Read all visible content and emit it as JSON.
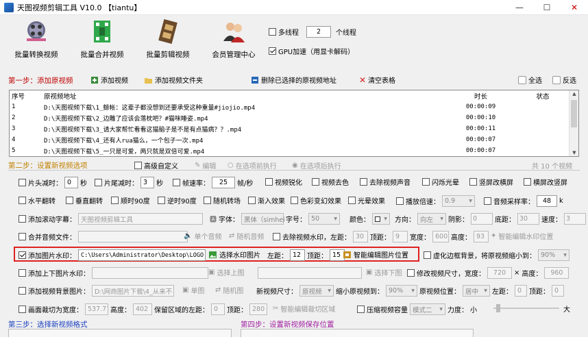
{
  "window": {
    "title": "天图视频剪辑工具 V10.0  【tiantu】",
    "minimize": "—",
    "maximize": "☐",
    "close": "✕"
  },
  "toolbar": {
    "batch_convert": "批量转换视频",
    "batch_merge": "批量合并视频",
    "batch_edit": "批量剪辑视频",
    "member_center": "会员管理中心",
    "multithread_label": "多线程",
    "thread_count": "2",
    "thread_unit": "个线程",
    "gpu_label": "GPU加速（用显卡解码）"
  },
  "step1": {
    "title": "第一步：添加原视频",
    "add_video": "添加视频",
    "add_folder": "添加视频文件夹",
    "delete_selected": "删除已选择的原视频地址",
    "clear_table": "清空表格",
    "select_all": "全选",
    "invert": "反选"
  },
  "table": {
    "headers": [
      "序号",
      "原视频地址",
      "时长",
      "状态"
    ],
    "rows": [
      {
        "n": "1",
        "path": "D:\\天图视频下载\\1_鲸帐：这辈子都没想到还要承受这种重量#jiojio.mp4",
        "dur": "00:00:09"
      },
      {
        "n": "2",
        "path": "D:\\天图视频下载\\2_边雕了应该会落枕吧？#猫咪睡姿.mp4",
        "dur": "00:00:10"
      },
      {
        "n": "3",
        "path": "D:\\天图视频下载\\3_请大家帮忙看看这猫脑子是不是有点猫病？？.mp4",
        "dur": "00:00:11"
      },
      {
        "n": "4",
        "path": "D:\\天图视频下载\\4_还有人rua猫么，一个包子一次.mp4",
        "dur": "00:00:07"
      },
      {
        "n": "5",
        "path": "D:\\天图视频下载\\5_一只是可爱，两只就是双倍可爱.mp4",
        "dur": "00:00:07"
      }
    ]
  },
  "step2": {
    "title": "第二步：设置新视频选项",
    "advanced": "高级自定义",
    "edit": "编辑",
    "before": "在选项前执行",
    "after": "在选项后执行",
    "count": "共 10 个视频"
  },
  "row1": {
    "head_cut": "片头减时：",
    "head_val": "0",
    "sec1": "秒",
    "tail_cut": "片尾减时：",
    "tail_val": "3",
    "sec2": "秒",
    "fps": "帧速率：",
    "fps_val": "25",
    "fps_unit": "帧/秒",
    "sharpen": "视频锐化",
    "decolor": "视频去色",
    "remove_audio": "去除视频声音",
    "flash": "闪烁光晕",
    "to_horizontal": "竖屏改横屏",
    "to_vertical": "横屏改竖屏"
  },
  "row2": {
    "hflip": "水平翻转",
    "vflip": "垂直翻转",
    "cw90": "顺时90度",
    "ccw90": "逆时90度",
    "random_trans": "随机转场",
    "fade_in": "渐入效果",
    "color_change": "色彩变幻效果",
    "glow": "光晕效果",
    "speed": "播放倍速：",
    "speed_val": "0.9",
    "sample_rate": "音频采样率：",
    "sample_val": "48",
    "sample_unit": "k"
  },
  "row3": {
    "subtitle": "添加滚动字幕：",
    "subtitle_val": "天图视频剪辑工具",
    "font": "字体：",
    "font_val": "黑体（simhei",
    "size": "字号：",
    "size_val": "50",
    "color": "颜色：",
    "dir": "方向：",
    "dir_val": "向左",
    "shadow": "阴影：",
    "shadow_val": "0",
    "bottom": "底距：",
    "bottom_val": "30",
    "speed": "速度：",
    "speed_val": "3"
  },
  "row4": {
    "merge_audio": "合并音频文件：",
    "single_audio": "单个音频",
    "random_audio": "随机音频",
    "remove_wm": "去除视频水印，左距：",
    "left_val": "30",
    "top": "顶距：",
    "top_val": "9",
    "width": "宽度：",
    "width_val": "600",
    "height": "高度：",
    "height_val": "93",
    "smart_wm": "智能编辑水印位置"
  },
  "row5": {
    "add_image_wm": "添加图片水印：",
    "path": "C:\\Users\\Administrator\\Desktop\\LOGO.",
    "select_img": "选择水印图片",
    "left": "左距：",
    "left_val": "12",
    "top": "顶距：",
    "top_val": "15",
    "smart_img": "智能编辑图片位置",
    "blur_bg": "虚化边框背景，将原视频缩小到：",
    "blur_val": "90%"
  },
  "row6": {
    "add_tb_wm": "添加上下图片水印：",
    "select_top": "选择上图",
    "select_bottom": "选择下图",
    "resize": "修改视频尺寸，宽度：",
    "w_val": "720",
    "x": "×",
    "height": "高度：",
    "h_val": "960"
  },
  "row7": {
    "add_bg": "添加视频背景图片：",
    "bg_path": "D:\\网商图片下载\\4_从来不",
    "single": "单图",
    "random": "随机图",
    "new_size": "新视频尺寸：",
    "new_size_val": "原视频",
    "shrink": "缩小原视频到：",
    "shrink_val": "90%",
    "pos": "原视频位置：",
    "pos_val": "居中",
    "left": "左距：",
    "left_val": "0",
    "top": "顶距：",
    "top_val": "0"
  },
  "row8": {
    "crop": "画面裁切为宽度：",
    "crop_w": "537.77",
    "height": "高度：",
    "h_val": "402",
    "keep_left": "保留区域的左距：",
    "left_val": "0",
    "top": "顶距：",
    "top_val": "280",
    "smart_crop": "智能编辑裁切区域",
    "compress": "压缩视频容量",
    "mode_val": "模式二",
    "strength": "力度：",
    "small": "小",
    "large": "大"
  },
  "step3": {
    "title": "第三步：选择新视频格式"
  },
  "step4": {
    "title": "第四步：设置新视频保存位置"
  }
}
